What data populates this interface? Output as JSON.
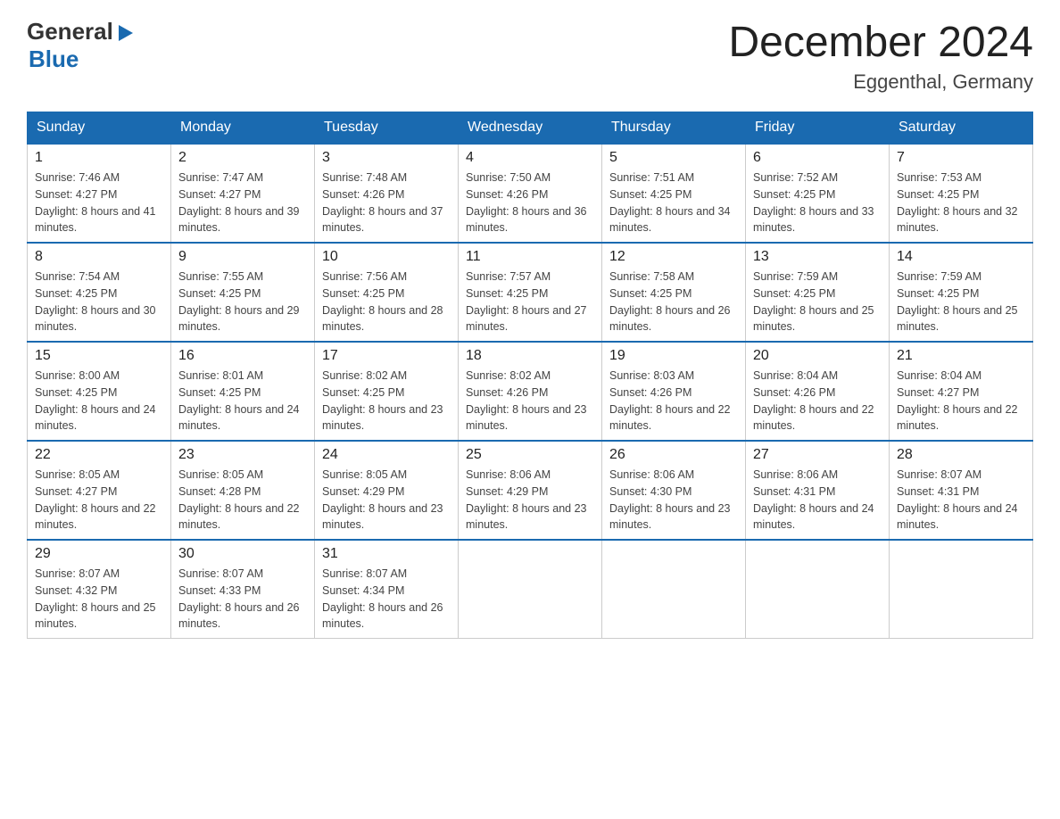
{
  "logo": {
    "general": "General",
    "triangle": "▶",
    "blue": "Blue"
  },
  "title": "December 2024",
  "location": "Eggenthal, Germany",
  "days_of_week": [
    "Sunday",
    "Monday",
    "Tuesday",
    "Wednesday",
    "Thursday",
    "Friday",
    "Saturday"
  ],
  "weeks": [
    [
      {
        "day": "1",
        "sunrise": "7:46 AM",
        "sunset": "4:27 PM",
        "daylight": "8 hours and 41 minutes."
      },
      {
        "day": "2",
        "sunrise": "7:47 AM",
        "sunset": "4:27 PM",
        "daylight": "8 hours and 39 minutes."
      },
      {
        "day": "3",
        "sunrise": "7:48 AM",
        "sunset": "4:26 PM",
        "daylight": "8 hours and 37 minutes."
      },
      {
        "day": "4",
        "sunrise": "7:50 AM",
        "sunset": "4:26 PM",
        "daylight": "8 hours and 36 minutes."
      },
      {
        "day": "5",
        "sunrise": "7:51 AM",
        "sunset": "4:25 PM",
        "daylight": "8 hours and 34 minutes."
      },
      {
        "day": "6",
        "sunrise": "7:52 AM",
        "sunset": "4:25 PM",
        "daylight": "8 hours and 33 minutes."
      },
      {
        "day": "7",
        "sunrise": "7:53 AM",
        "sunset": "4:25 PM",
        "daylight": "8 hours and 32 minutes."
      }
    ],
    [
      {
        "day": "8",
        "sunrise": "7:54 AM",
        "sunset": "4:25 PM",
        "daylight": "8 hours and 30 minutes."
      },
      {
        "day": "9",
        "sunrise": "7:55 AM",
        "sunset": "4:25 PM",
        "daylight": "8 hours and 29 minutes."
      },
      {
        "day": "10",
        "sunrise": "7:56 AM",
        "sunset": "4:25 PM",
        "daylight": "8 hours and 28 minutes."
      },
      {
        "day": "11",
        "sunrise": "7:57 AM",
        "sunset": "4:25 PM",
        "daylight": "8 hours and 27 minutes."
      },
      {
        "day": "12",
        "sunrise": "7:58 AM",
        "sunset": "4:25 PM",
        "daylight": "8 hours and 26 minutes."
      },
      {
        "day": "13",
        "sunrise": "7:59 AM",
        "sunset": "4:25 PM",
        "daylight": "8 hours and 25 minutes."
      },
      {
        "day": "14",
        "sunrise": "7:59 AM",
        "sunset": "4:25 PM",
        "daylight": "8 hours and 25 minutes."
      }
    ],
    [
      {
        "day": "15",
        "sunrise": "8:00 AM",
        "sunset": "4:25 PM",
        "daylight": "8 hours and 24 minutes."
      },
      {
        "day": "16",
        "sunrise": "8:01 AM",
        "sunset": "4:25 PM",
        "daylight": "8 hours and 24 minutes."
      },
      {
        "day": "17",
        "sunrise": "8:02 AM",
        "sunset": "4:25 PM",
        "daylight": "8 hours and 23 minutes."
      },
      {
        "day": "18",
        "sunrise": "8:02 AM",
        "sunset": "4:26 PM",
        "daylight": "8 hours and 23 minutes."
      },
      {
        "day": "19",
        "sunrise": "8:03 AM",
        "sunset": "4:26 PM",
        "daylight": "8 hours and 22 minutes."
      },
      {
        "day": "20",
        "sunrise": "8:04 AM",
        "sunset": "4:26 PM",
        "daylight": "8 hours and 22 minutes."
      },
      {
        "day": "21",
        "sunrise": "8:04 AM",
        "sunset": "4:27 PM",
        "daylight": "8 hours and 22 minutes."
      }
    ],
    [
      {
        "day": "22",
        "sunrise": "8:05 AM",
        "sunset": "4:27 PM",
        "daylight": "8 hours and 22 minutes."
      },
      {
        "day": "23",
        "sunrise": "8:05 AM",
        "sunset": "4:28 PM",
        "daylight": "8 hours and 22 minutes."
      },
      {
        "day": "24",
        "sunrise": "8:05 AM",
        "sunset": "4:29 PM",
        "daylight": "8 hours and 23 minutes."
      },
      {
        "day": "25",
        "sunrise": "8:06 AM",
        "sunset": "4:29 PM",
        "daylight": "8 hours and 23 minutes."
      },
      {
        "day": "26",
        "sunrise": "8:06 AM",
        "sunset": "4:30 PM",
        "daylight": "8 hours and 23 minutes."
      },
      {
        "day": "27",
        "sunrise": "8:06 AM",
        "sunset": "4:31 PM",
        "daylight": "8 hours and 24 minutes."
      },
      {
        "day": "28",
        "sunrise": "8:07 AM",
        "sunset": "4:31 PM",
        "daylight": "8 hours and 24 minutes."
      }
    ],
    [
      {
        "day": "29",
        "sunrise": "8:07 AM",
        "sunset": "4:32 PM",
        "daylight": "8 hours and 25 minutes."
      },
      {
        "day": "30",
        "sunrise": "8:07 AM",
        "sunset": "4:33 PM",
        "daylight": "8 hours and 26 minutes."
      },
      {
        "day": "31",
        "sunrise": "8:07 AM",
        "sunset": "4:34 PM",
        "daylight": "8 hours and 26 minutes."
      },
      null,
      null,
      null,
      null
    ]
  ]
}
